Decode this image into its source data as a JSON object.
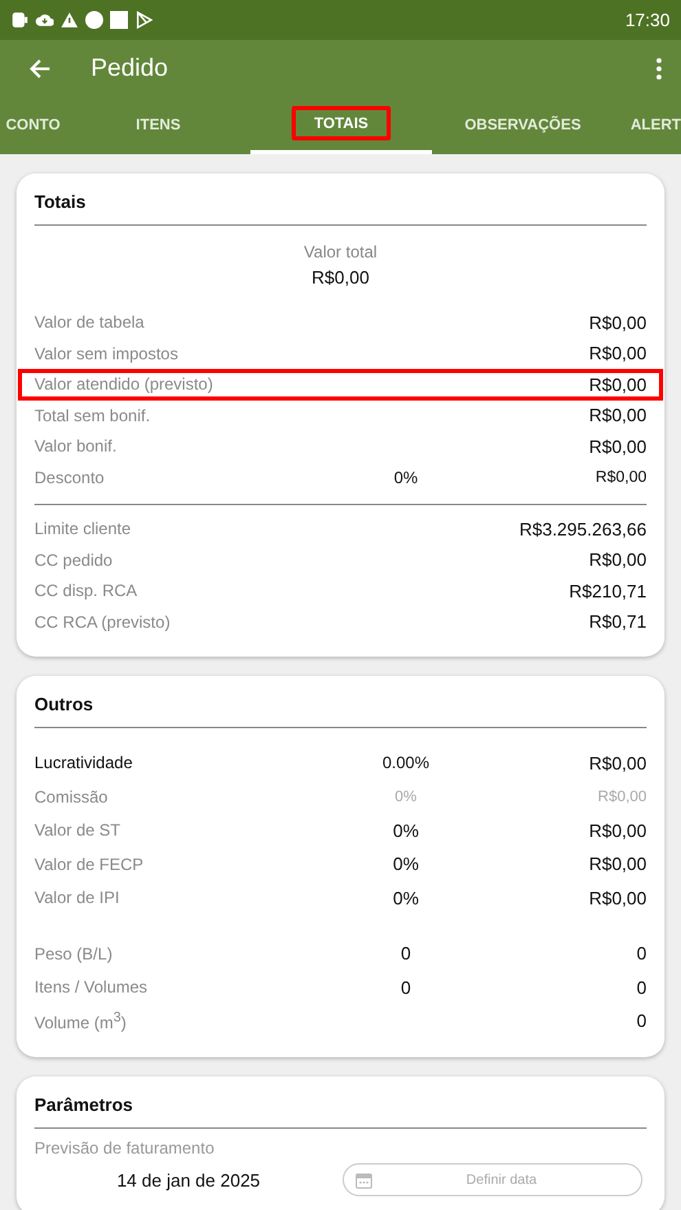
{
  "status_bar": {
    "time": "17:30"
  },
  "app_bar": {
    "title": "Pedido"
  },
  "tabs": [
    {
      "label": "CONTO",
      "selected": false,
      "highlighted": false
    },
    {
      "label": "ITENS",
      "selected": false,
      "highlighted": false
    },
    {
      "label": "TOTAIS",
      "selected": true,
      "highlighted": true
    },
    {
      "label": "OBSERVAÇÕES",
      "selected": false,
      "highlighted": false
    },
    {
      "label": "ALERT",
      "selected": false,
      "highlighted": false
    }
  ],
  "cards": [
    {
      "title": "Totais",
      "total": {
        "label": "Valor total",
        "value": "R$0,00"
      },
      "groups": [
        {
          "divider": false,
          "rows": [
            {
              "kind": "normal",
              "label": "Valor de tabela",
              "value": "R$0,00",
              "highlighted": false
            },
            {
              "kind": "normal",
              "label": "Valor sem impostos",
              "value": "R$0,00",
              "highlighted": false
            },
            {
              "kind": "normal",
              "label": "Valor atendido (previsto)",
              "value": "R$0,00",
              "highlighted": true
            },
            {
              "kind": "normal",
              "label": "Total sem bonif.",
              "value": "R$0,00",
              "highlighted": false
            },
            {
              "kind": "normal",
              "label": "Valor bonif.",
              "value": "R$0,00",
              "highlighted": false
            },
            {
              "kind": "small",
              "label": "Desconto",
              "middle": "0%",
              "value": "R$0,00",
              "highlighted": false
            }
          ]
        },
        {
          "divider": true,
          "rows": [
            {
              "kind": "normal",
              "label": "Limite cliente",
              "value": "R$3.295.263,66",
              "highlighted": false
            },
            {
              "kind": "normal",
              "label": "CC pedido",
              "value": "R$0,00",
              "highlighted": false
            },
            {
              "kind": "normal",
              "label": "CC disp. RCA",
              "value": "R$210,71",
              "highlighted": false
            },
            {
              "kind": "normal",
              "label": "CC RCA (previsto)",
              "value": "R$0,71",
              "highlighted": false
            }
          ]
        }
      ]
    },
    {
      "title": "Outros",
      "groups": [
        {
          "divider": false,
          "rows": [
            {
              "kind": "primary",
              "label": "Lucratividade",
              "middle": "0.00%",
              "value": "R$0,00",
              "highlighted": false
            },
            {
              "kind": "muted",
              "label": "Comissão",
              "middle": "0%",
              "value": "R$0,00",
              "highlighted": false
            },
            {
              "kind": "normal",
              "label": "Valor de ST",
              "middle": "0%",
              "value": "R$0,00",
              "highlighted": false
            },
            {
              "kind": "normal",
              "label": "Valor de FECP",
              "middle": "0%",
              "value": "R$0,00",
              "highlighted": false
            },
            {
              "kind": "normal",
              "label": "Valor de IPI",
              "middle": "0%",
              "value": "R$0,00",
              "highlighted": false
            }
          ]
        },
        {
          "divider": false,
          "rows": [
            {
              "kind": "normal",
              "label": "Peso (B/L)",
              "middle": "0",
              "value": "0",
              "highlighted": false
            },
            {
              "kind": "normal",
              "label": "Itens / Volumes",
              "middle": "0",
              "value": "0",
              "highlighted": false
            },
            {
              "kind": "normal",
              "label": "Volume (m$^{3}$)",
              "value": "0",
              "highlighted": false
            }
          ]
        }
      ]
    }
  ],
  "parametros": {
    "title": "Parâmetros",
    "label": "Previsão de faturamento",
    "date": "14 de jan de 2025",
    "button": "Definir data"
  }
}
